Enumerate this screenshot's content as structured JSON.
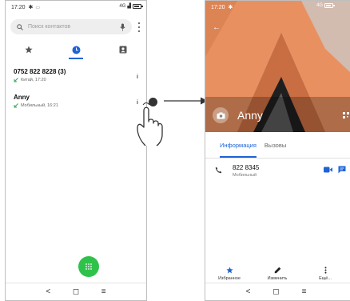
{
  "left_phone": {
    "status": {
      "time": "17:20",
      "network": "4G"
    },
    "search": {
      "placeholder": "Поиск контактов"
    },
    "tabs": [
      {
        "icon": "star-icon",
        "active": false
      },
      {
        "icon": "clock-icon",
        "active": true
      },
      {
        "icon": "contacts-icon",
        "active": false
      }
    ],
    "calls": [
      {
        "number": "0752 822 8228 (3)",
        "detail": "Китай, 17:20"
      },
      {
        "number": "Anny",
        "detail": "Мобильный, 16:21"
      }
    ],
    "fab_icon": "dialpad-icon",
    "nav": {
      "back": "<",
      "home": "◻",
      "menu": "≡"
    }
  },
  "right_phone": {
    "status": {
      "time": "17:20",
      "network": "4G"
    },
    "contact_name": "Anny",
    "tabs": [
      {
        "label": "Информация",
        "active": true
      },
      {
        "label": "Вызовы",
        "active": false
      }
    ],
    "phone": {
      "number": "822 8345",
      "type": "Мобильный"
    },
    "actions": [
      {
        "icon": "star-icon",
        "label": "Избранное"
      },
      {
        "icon": "pencil-icon",
        "label": "Изменить"
      },
      {
        "icon": "more-icon",
        "label": "Ещё..."
      }
    ],
    "nav": {
      "back": "<",
      "home": "◻",
      "menu": "≡"
    }
  },
  "colors": {
    "accent": "#1e63d6",
    "fab": "#2fc24a",
    "call_in": "#2fa84f"
  }
}
